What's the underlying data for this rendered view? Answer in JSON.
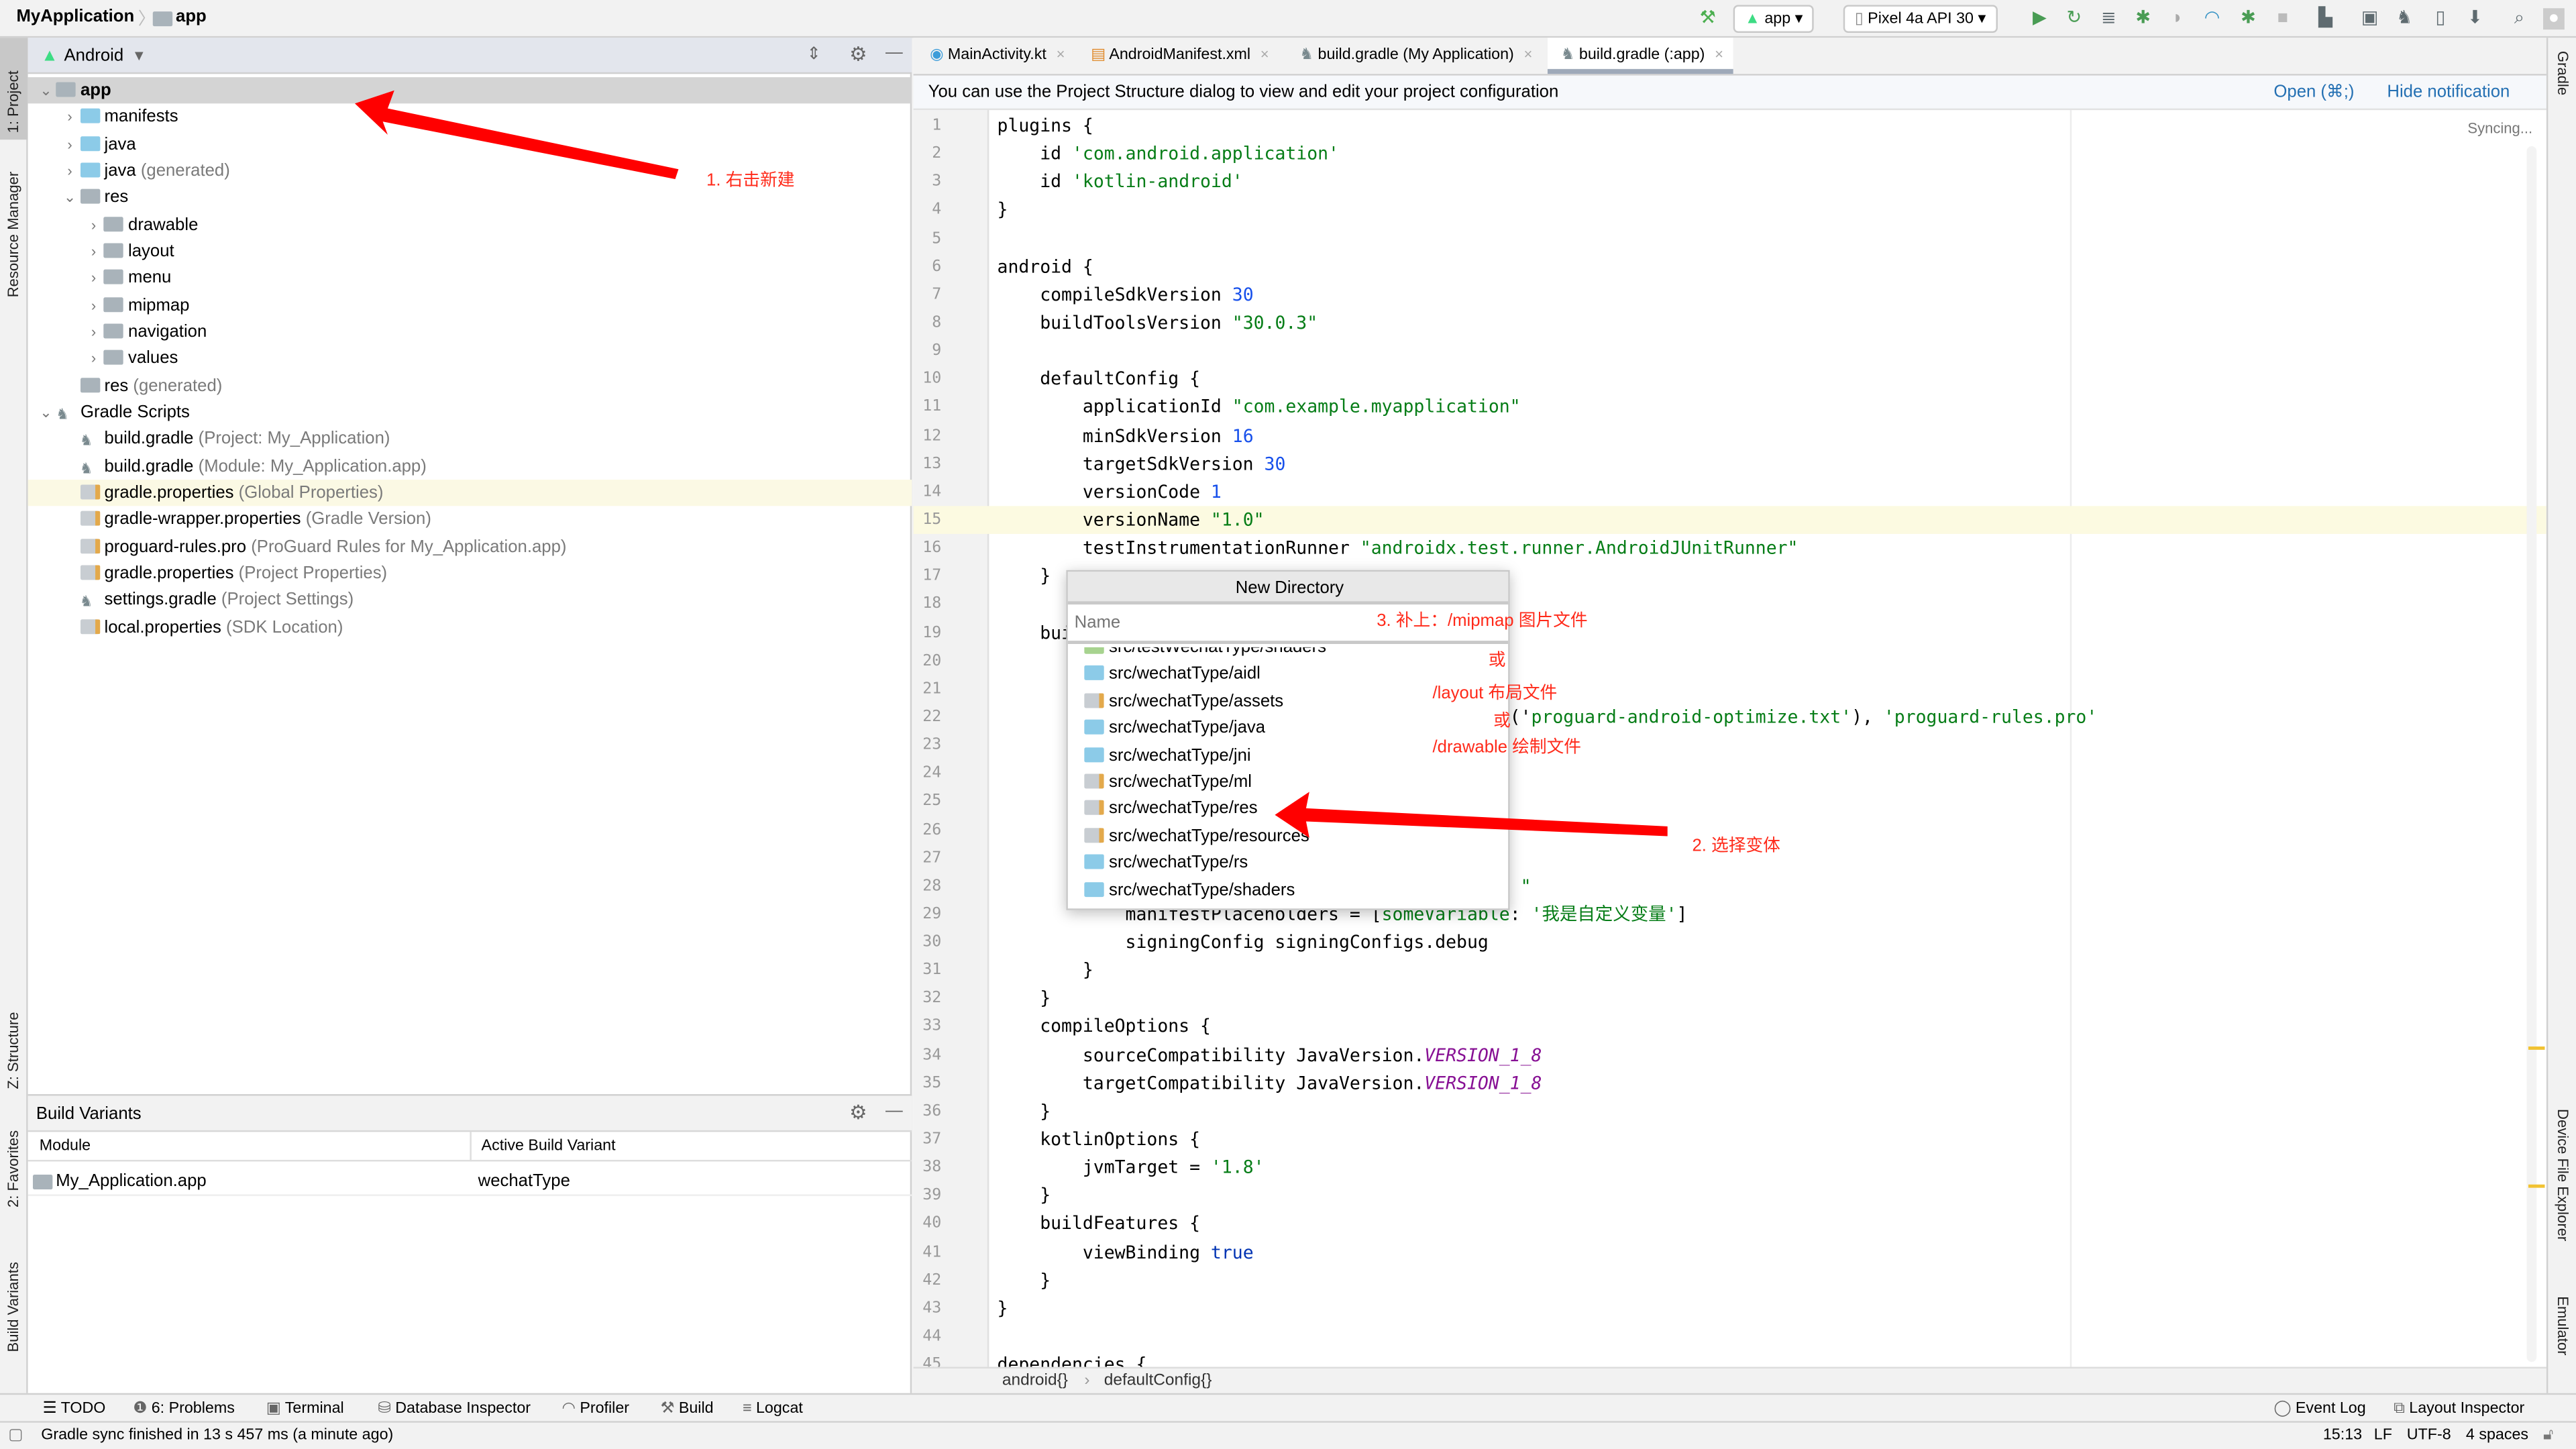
{
  "navbar": {
    "project": "MyApplication",
    "module": "app",
    "run_config": "app",
    "device": "Pixel 4a API 30",
    "toolbar_icons": [
      "hammer-icon",
      "run-icon",
      "apply-changes-icon",
      "apply-code-changes-icon",
      "debug-icon",
      "attach-debugger-icon",
      "profile-icon",
      "debug-attach-icon",
      "stop-icon",
      "project-structure-icon",
      "sdk-manager-icon",
      "sync-gradle-icon",
      "avd-manager-icon",
      "sdk-download-icon",
      "search-icon",
      "account-icon"
    ]
  },
  "left_strip": [
    "1: Project",
    "Resource Manager",
    "Z: Structure",
    "2: Favorites",
    "Build Variants"
  ],
  "right_strip": [
    "Gradle",
    "Device File Explorer",
    "Emulator"
  ],
  "project_panel": {
    "view": "Android",
    "tree": [
      {
        "label": "app",
        "sec": "",
        "level": 0,
        "exp": "open",
        "icon": "grey",
        "bold": true,
        "sel": true
      },
      {
        "label": "manifests",
        "sec": "",
        "level": 1,
        "exp": "closed",
        "icon": "blue"
      },
      {
        "label": "java",
        "sec": "",
        "level": 1,
        "exp": "closed",
        "icon": "blue"
      },
      {
        "label": "java",
        "sec": " (generated)",
        "level": 1,
        "exp": "closed",
        "icon": "blue"
      },
      {
        "label": "res",
        "sec": "",
        "level": 1,
        "exp": "open",
        "icon": "grey"
      },
      {
        "label": "drawable",
        "sec": "",
        "level": 2,
        "exp": "closed",
        "icon": "grey"
      },
      {
        "label": "layout",
        "sec": "",
        "level": 2,
        "exp": "closed",
        "icon": "grey"
      },
      {
        "label": "menu",
        "sec": "",
        "level": 2,
        "exp": "closed",
        "icon": "grey"
      },
      {
        "label": "mipmap",
        "sec": "",
        "level": 2,
        "exp": "closed",
        "icon": "grey"
      },
      {
        "label": "navigation",
        "sec": "",
        "level": 2,
        "exp": "closed",
        "icon": "grey"
      },
      {
        "label": "values",
        "sec": "",
        "level": 2,
        "exp": "closed",
        "icon": "grey"
      },
      {
        "label": "res",
        "sec": " (generated)",
        "level": 1,
        "exp": "none",
        "icon": "grey"
      },
      {
        "label": "Gradle Scripts",
        "sec": "",
        "level": 0,
        "exp": "open",
        "icon": "gradle"
      },
      {
        "label": "build.gradle",
        "sec": " (Project: My_Application)",
        "level": 1,
        "exp": "none",
        "icon": "gradle"
      },
      {
        "label": "build.gradle",
        "sec": " (Module: My_Application.app)",
        "level": 1,
        "exp": "none",
        "icon": "gradle"
      },
      {
        "label": "gradle.properties",
        "sec": " (Global Properties)",
        "level": 1,
        "exp": "none",
        "icon": "props",
        "hl": true
      },
      {
        "label": "gradle-wrapper.properties",
        "sec": " (Gradle Version)",
        "level": 1,
        "exp": "none",
        "icon": "props"
      },
      {
        "label": "proguard-rules.pro",
        "sec": " (ProGuard Rules for My_Application.app)",
        "level": 1,
        "exp": "none",
        "icon": "props"
      },
      {
        "label": "gradle.properties",
        "sec": " (Project Properties)",
        "level": 1,
        "exp": "none",
        "icon": "props"
      },
      {
        "label": "settings.gradle",
        "sec": " (Project Settings)",
        "level": 1,
        "exp": "none",
        "icon": "gradle"
      },
      {
        "label": "local.properties",
        "sec": " (SDK Location)",
        "level": 1,
        "exp": "none",
        "icon": "props"
      }
    ]
  },
  "build_variants": {
    "title": "Build Variants",
    "col_module": "Module",
    "col_variant": "Active Build Variant",
    "rows": [
      {
        "module": "My_Application.app",
        "variant": "wechatType"
      }
    ]
  },
  "editor": {
    "tabs": [
      {
        "label": "MainActivity.kt",
        "active": false
      },
      {
        "label": "AndroidManifest.xml",
        "active": false
      },
      {
        "label": "build.gradle (My Application)",
        "active": false
      },
      {
        "label": "build.gradle (:app)",
        "active": true
      }
    ],
    "notification": "You can use the Project Structure dialog to view and edit your project configuration",
    "notif_open": "Open (⌘;)",
    "notif_hide": "Hide notification",
    "syncing": "Syncing...",
    "current_line": 15,
    "lines": [
      [
        [
          "plugins {",
          "p"
        ]
      ],
      [
        [
          "    id ",
          "p"
        ],
        [
          "'com.android.application'",
          "s"
        ]
      ],
      [
        [
          "    id ",
          "p"
        ],
        [
          "'kotlin-android'",
          "s"
        ]
      ],
      [
        [
          "}",
          "p"
        ]
      ],
      [],
      [
        [
          "android {",
          "p"
        ]
      ],
      [
        [
          "    compileSdkVersion ",
          "p"
        ],
        [
          "30",
          "n"
        ]
      ],
      [
        [
          "    buildToolsVersion ",
          "p"
        ],
        [
          "\"30.0.3\"",
          "s"
        ]
      ],
      [],
      [
        [
          "    defaultConfig {",
          "p"
        ]
      ],
      [
        [
          "        applicationId ",
          "p"
        ],
        [
          "\"com.example.myapplication\"",
          "s"
        ]
      ],
      [
        [
          "        minSdkVersion ",
          "p"
        ],
        [
          "16",
          "n"
        ]
      ],
      [
        [
          "        targetSdkVersion ",
          "p"
        ],
        [
          "30",
          "n"
        ]
      ],
      [
        [
          "        versionCode ",
          "p"
        ],
        [
          "1",
          "n"
        ]
      ],
      [
        [
          "        versionName ",
          "p"
        ],
        [
          "\"1.0\"",
          "s"
        ]
      ],
      [
        [
          "        testInstrumentationRunner ",
          "p"
        ],
        [
          "\"androidx.test.runner.AndroidJUnitRunner\"",
          "s"
        ]
      ],
      [
        [
          "    }",
          "p"
        ]
      ],
      [],
      [
        [
          "    bui",
          "p"
        ]
      ],
      [],
      [],
      [
        [
          "                                                ('",
          "p"
        ],
        [
          "proguard-android-optimize.txt'",
          "s"
        ],
        [
          "), ",
          "p"
        ],
        [
          "'proguard-rules.pro'",
          "s"
        ]
      ],
      [],
      [],
      [],
      [],
      [],
      [
        [
          "                                                 \"",
          "s"
        ]
      ],
      [
        [
          "            manifestPlaceholders = [",
          "p"
        ],
        [
          "someVariable",
          "s"
        ],
        [
          ": ",
          "p"
        ],
        [
          "'我是自定义变量'",
          "s"
        ],
        [
          "]",
          "p"
        ]
      ],
      [
        [
          "            signingConfig signingConfigs.debug",
          "p"
        ]
      ],
      [
        [
          "        }",
          "p"
        ]
      ],
      [
        [
          "    }",
          "p"
        ]
      ],
      [
        [
          "    compileOptions {",
          "p"
        ]
      ],
      [
        [
          "        sourceCompatibility JavaVersion.",
          "p"
        ],
        [
          "VERSION_1_8",
          "c"
        ]
      ],
      [
        [
          "        targetCompatibility JavaVersion.",
          "p"
        ],
        [
          "VERSION_1_8",
          "c"
        ]
      ],
      [
        [
          "    }",
          "p"
        ]
      ],
      [
        [
          "    kotlinOptions {",
          "p"
        ]
      ],
      [
        [
          "        jvmTarget = ",
          "p"
        ],
        [
          "'1.8'",
          "s"
        ]
      ],
      [
        [
          "    }",
          "p"
        ]
      ],
      [
        [
          "    buildFeatures {",
          "p"
        ]
      ],
      [
        [
          "        viewBinding ",
          "p"
        ],
        [
          "true",
          "k"
        ]
      ],
      [
        [
          "    }",
          "p"
        ]
      ],
      [
        [
          "}",
          "p"
        ]
      ],
      [],
      [
        [
          "dependencies {",
          "p"
        ]
      ]
    ],
    "breadcrumb": [
      "android{}",
      "defaultConfig{}"
    ]
  },
  "new_directory_popup": {
    "title": "New Directory",
    "placeholder": "Name",
    "items": [
      {
        "label": "src/testWechatType/shaders",
        "icon": "green"
      },
      {
        "label": "src/wechatType/aidl",
        "icon": "blue"
      },
      {
        "label": "src/wechatType/assets",
        "icon": "props"
      },
      {
        "label": "src/wechatType/java",
        "icon": "blue"
      },
      {
        "label": "src/wechatType/jni",
        "icon": "blue"
      },
      {
        "label": "src/wechatType/ml",
        "icon": "props"
      },
      {
        "label": "src/wechatType/res",
        "icon": "props"
      },
      {
        "label": "src/wechatType/resources",
        "icon": "props"
      },
      {
        "label": "src/wechatType/rs",
        "icon": "blue"
      },
      {
        "label": "src/wechatType/shaders",
        "icon": "blue"
      }
    ]
  },
  "annotations": {
    "a1": "1. 右击新建",
    "a2": "2. 选择变体",
    "a3": "3. 补上：/mipmap  图片文件",
    "or1": "或",
    "layout": "/layout  布局文件",
    "or2": "或",
    "drawable": "/drawable  绘制文件",
    "color": "#ff2a1a"
  },
  "bottom_tools": {
    "todo": "TODO",
    "problems": "6: Problems",
    "terminal": "Terminal",
    "db": "Database Inspector",
    "profiler": "Profiler",
    "build": "Build",
    "logcat": "Logcat",
    "event_log": "Event Log",
    "layout_inspector": "Layout Inspector"
  },
  "status": {
    "message": "Gradle sync finished in 13 s 457 ms (a minute ago)",
    "position": "15:13",
    "line_sep": "LF",
    "encoding": "UTF-8",
    "indent": "4 spaces"
  }
}
